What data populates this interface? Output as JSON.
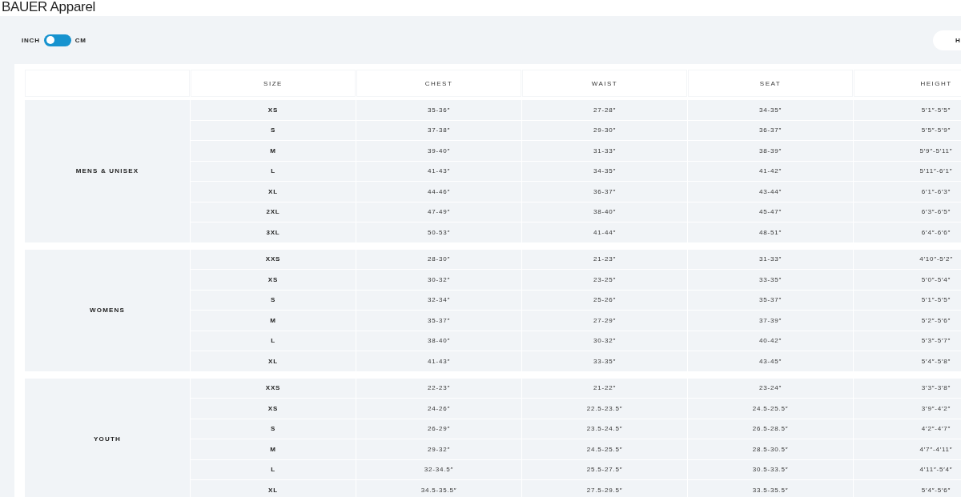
{
  "title": "BAUER Apparel",
  "unit_toggle": {
    "left_label": "INCH",
    "right_label": "CM",
    "on": false
  },
  "top_right_button": {
    "label": "H"
  },
  "table": {
    "columns": [
      "SIZE",
      "CHEST",
      "WAIST",
      "SEAT",
      "HEIGHT"
    ],
    "groups": [
      {
        "name": "MENS & UNISEX",
        "rows": [
          [
            "XS",
            "35-36″",
            "27-28″",
            "34-35″",
            "5′1″-5′5″"
          ],
          [
            "S",
            "37-38″",
            "29-30″",
            "36-37″",
            "5′5″-5′9″"
          ],
          [
            "M",
            "39-40″",
            "31-33″",
            "38-39″",
            "5′9″-5′11″"
          ],
          [
            "L",
            "41-43″",
            "34-35″",
            "41-42″",
            "5′11″-6′1″"
          ],
          [
            "XL",
            "44-46″",
            "36-37″",
            "43-44″",
            "6′1″-6′3″"
          ],
          [
            "2XL",
            "47-49″",
            "38-40″",
            "45-47″",
            "6′3″-6′5″"
          ],
          [
            "3XL",
            "50-53″",
            "41-44″",
            "48-51″",
            "6′4″-6′6″"
          ]
        ]
      },
      {
        "name": "WOMENS",
        "rows": [
          [
            "XXS",
            "28-30″",
            "21-23″",
            "31-33″",
            "4′10″-5′2″"
          ],
          [
            "XS",
            "30-32″",
            "23-25″",
            "33-35″",
            "5′0″-5′4″"
          ],
          [
            "S",
            "32-34″",
            "25-26″",
            "35-37″",
            "5′1″-5′5″"
          ],
          [
            "M",
            "35-37″",
            "27-29″",
            "37-39″",
            "5′2″-5′6″"
          ],
          [
            "L",
            "38-40″",
            "30-32″",
            "40-42″",
            "5′3″-5′7″"
          ],
          [
            "XL",
            "41-43″",
            "33-35″",
            "43-45″",
            "5′4″-5′8″"
          ]
        ]
      },
      {
        "name": "YOUTH",
        "rows": [
          [
            "XXS",
            "22-23″",
            "21-22″",
            "23-24″",
            "3′3″-3′8″"
          ],
          [
            "XS",
            "24-26″",
            "22.5-23.5″",
            "24.5-25.5″",
            "3′9″-4′2″"
          ],
          [
            "S",
            "26-29″",
            "23.5-24.5″",
            "26.5-28.5″",
            "4′2″-4′7″"
          ],
          [
            "M",
            "29-32″",
            "24.5-25.5″",
            "28.5-30.5″",
            "4′7″-4′11″"
          ],
          [
            "L",
            "32-34.5″",
            "25.5-27.5″",
            "30.5-33.5″",
            "4′11″-5′4″"
          ],
          [
            "XL",
            "34.5-35.5″",
            "27.5-29.5″",
            "33.5-35.5″",
            "5′4″-5′6″"
          ]
        ]
      }
    ]
  }
}
